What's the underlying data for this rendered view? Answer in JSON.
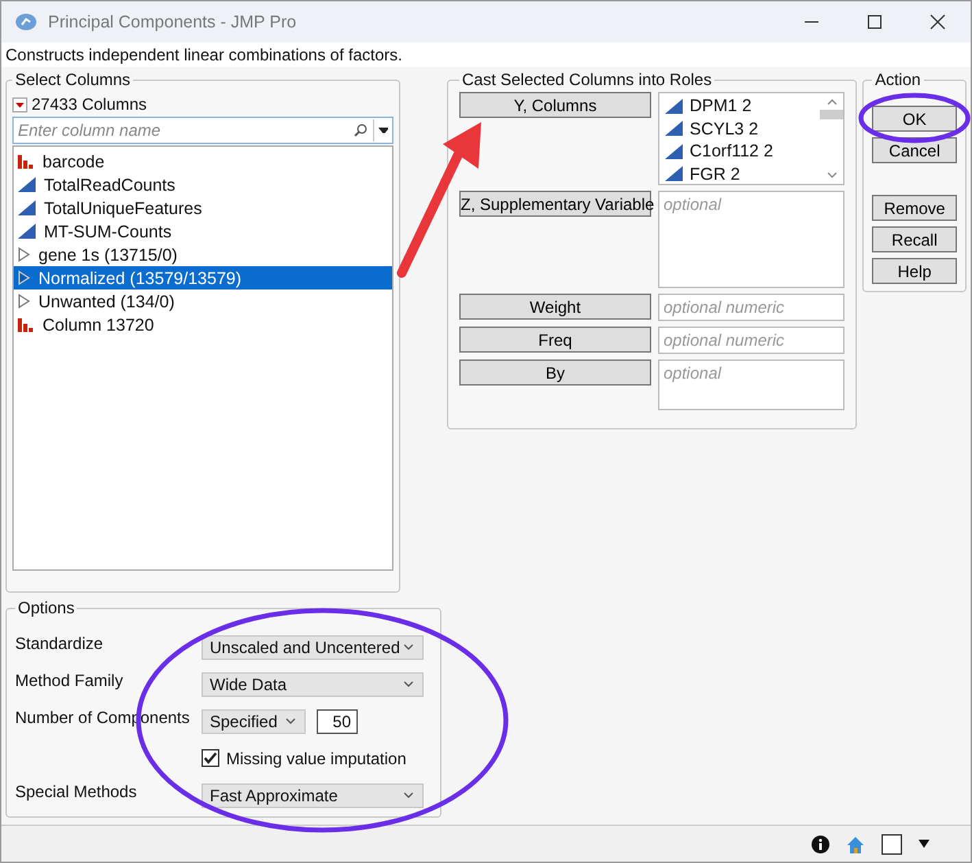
{
  "window": {
    "title": "Principal Components - JMP Pro"
  },
  "description": "Constructs independent linear combinations of factors.",
  "select_columns": {
    "title": "Select Columns",
    "count": "27433 Columns",
    "search": {
      "placeholder": "Enter column name"
    },
    "items": [
      {
        "label": "barcode",
        "kind": "nominal",
        "selected": false
      },
      {
        "label": "TotalReadCounts",
        "kind": "continuous",
        "selected": false
      },
      {
        "label": "TotalUniqueFeatures",
        "kind": "continuous",
        "selected": false
      },
      {
        "label": "MT-SUM-Counts",
        "kind": "continuous",
        "selected": false
      },
      {
        "label": "gene 1s (13715/0)",
        "kind": "group",
        "selected": false
      },
      {
        "label": "Normalized (13579/13579)",
        "kind": "group",
        "selected": true
      },
      {
        "label": "Unwanted (134/0)",
        "kind": "group",
        "selected": false
      },
      {
        "label": "Column 13720",
        "kind": "nominal",
        "selected": false
      }
    ]
  },
  "roles": {
    "title": "Cast Selected Columns into Roles",
    "rows": [
      {
        "button": "Y, Columns",
        "kind": "list",
        "values": [
          "DPM1 2",
          "SCYL3 2",
          "C1orf112 2",
          "FGR 2"
        ]
      },
      {
        "button": "Z, Supplementary Variable",
        "kind": "tall",
        "placeholder": "optional"
      },
      {
        "button": "Weight",
        "kind": "single",
        "placeholder": "optional numeric"
      },
      {
        "button": "Freq",
        "kind": "single",
        "placeholder": "optional numeric"
      },
      {
        "button": "By",
        "kind": "medium",
        "placeholder": "optional"
      }
    ]
  },
  "action": {
    "title": "Action",
    "buttons": [
      [
        "OK",
        "Cancel"
      ],
      [
        "Remove",
        "Recall",
        "Help"
      ]
    ]
  },
  "options": {
    "title": "Options",
    "rows": [
      {
        "label": "Standardize",
        "kind": "select",
        "value": "Unscaled and Uncentered"
      },
      {
        "label": "Method Family",
        "kind": "select",
        "value": "Wide Data"
      },
      {
        "label": "Number of Components",
        "kind": "select-number",
        "value": "Specified",
        "number": "50"
      },
      {
        "label": "Missing value imputation",
        "kind": "checkbox",
        "checked": true
      },
      {
        "label": "Special Methods",
        "kind": "select",
        "value": "Fast Approximate"
      }
    ]
  }
}
